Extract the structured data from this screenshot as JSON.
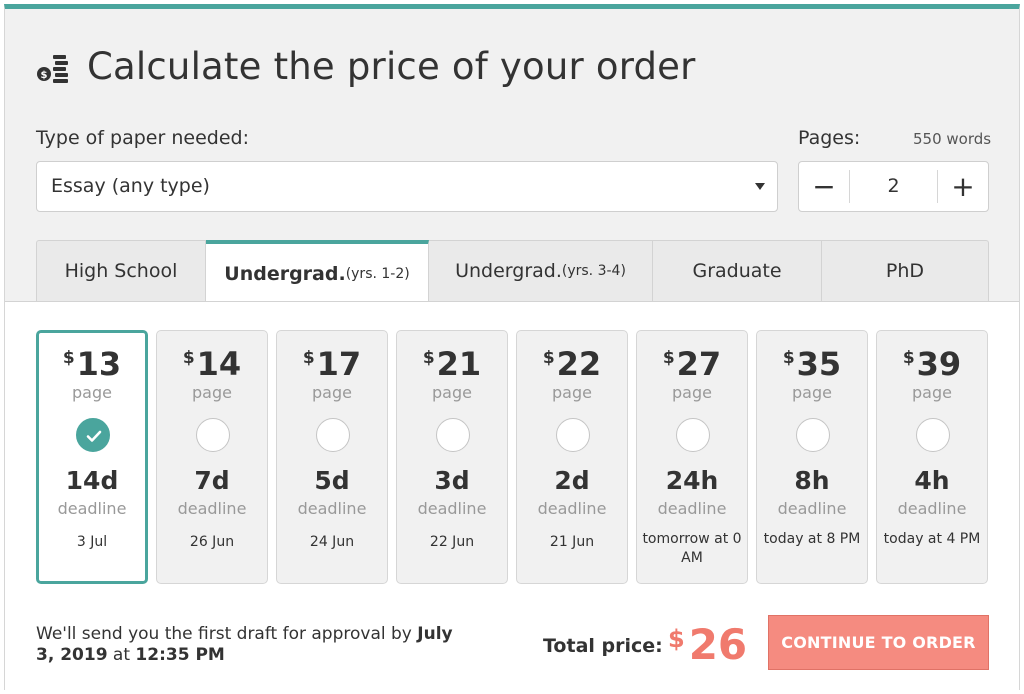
{
  "header": {
    "icon": "coins-icon",
    "title": "Calculate the price of your order"
  },
  "paper": {
    "label": "Type of paper needed:",
    "value": "Essay (any type)"
  },
  "pages": {
    "label": "Pages:",
    "words": "550 words",
    "minus": "−",
    "value": "2",
    "plus": "+"
  },
  "tabs": [
    {
      "label": "High School",
      "sub": ""
    },
    {
      "label": "Undergrad.",
      "sub": "(yrs. 1-2)"
    },
    {
      "label": "Undergrad.",
      "sub": "(yrs. 3-4)"
    },
    {
      "label": "Graduate",
      "sub": ""
    },
    {
      "label": "PhD",
      "sub": ""
    }
  ],
  "active_tab_index": 1,
  "currency": "$",
  "unit": "page",
  "deadline_label": "deadline",
  "options": [
    {
      "price": "13",
      "duration": "14d",
      "date": "3 Jul",
      "selected": true
    },
    {
      "price": "14",
      "duration": "7d",
      "date": "26 Jun"
    },
    {
      "price": "17",
      "duration": "5d",
      "date": "24 Jun"
    },
    {
      "price": "21",
      "duration": "3d",
      "date": "22 Jun"
    },
    {
      "price": "22",
      "duration": "2d",
      "date": "21 Jun"
    },
    {
      "price": "27",
      "duration": "24h",
      "date": "tomorrow at 0 AM"
    },
    {
      "price": "35",
      "duration": "8h",
      "date": "today at 8 PM"
    },
    {
      "price": "39",
      "duration": "4h",
      "date": "today at 4 PM"
    }
  ],
  "draft": {
    "text": "We'll send you the first draft for approval by ",
    "date": "July 3, 2019",
    "at": " at ",
    "time": "12:35 PM"
  },
  "total": {
    "label": "Total price:",
    "currency": "$",
    "value": "26"
  },
  "cta": {
    "label": "CONTINUE TO ORDER"
  },
  "colors": {
    "accent": "#4aa59d",
    "price": "#f07a6d",
    "cta": "#f58b80"
  }
}
